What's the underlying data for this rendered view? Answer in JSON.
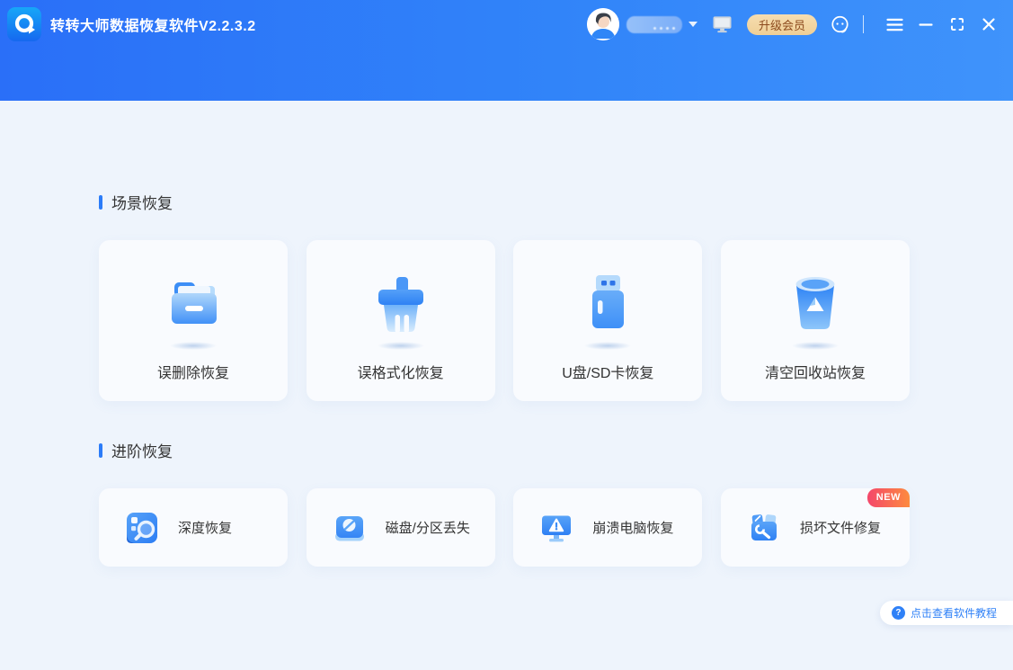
{
  "app": {
    "title": "转转大师数据恢复软件V2.2.3.2",
    "logo_icon": "q-arrow-logo-icon"
  },
  "titlebar": {
    "upgrade_button": "升级会员",
    "username_visible": false,
    "icon_names": [
      "user-avatar",
      "chevron-down-icon",
      "monitor-icon",
      "customer-service-icon",
      "menu-icon",
      "minimize-icon",
      "maximize-icon",
      "close-icon"
    ]
  },
  "sections": {
    "scene": {
      "title": "场景恢复",
      "cards": [
        {
          "label": "误删除恢复",
          "icon": "folder-icon"
        },
        {
          "label": "误格式化恢复",
          "icon": "brush-icon"
        },
        {
          "label": "U盘/SD卡恢复",
          "icon": "usb-drive-icon"
        },
        {
          "label": "清空回收站恢复",
          "icon": "recycle-bin-icon"
        }
      ]
    },
    "advanced": {
      "title": "进阶恢复",
      "cards": [
        {
          "label": "深度恢复",
          "icon": "deep-scan-icon"
        },
        {
          "label": "磁盘/分区丢失",
          "icon": "disk-partition-icon"
        },
        {
          "label": "崩溃电脑恢复",
          "icon": "crashed-pc-icon"
        },
        {
          "label": "损坏文件修复",
          "icon": "file-repair-icon",
          "badge": "NEW"
        }
      ]
    }
  },
  "footer": {
    "tutorial_button": "点击查看软件教程",
    "help_glyph": "?"
  },
  "colors": {
    "header_gradient_start": "#2a6ff8",
    "header_gradient_end": "#3f93fb",
    "page_background": "#eef4fc",
    "card_background": "#f9fbfe",
    "accent_blue": "#2b7cf8",
    "text_dark": "#333333",
    "upgrade_bg": "#f2d5a2",
    "upgrade_text": "#8c4a1d",
    "new_badge_start": "#f4476b",
    "new_badge_end": "#fd8b3f",
    "tutorial_text": "#2f81f7"
  }
}
